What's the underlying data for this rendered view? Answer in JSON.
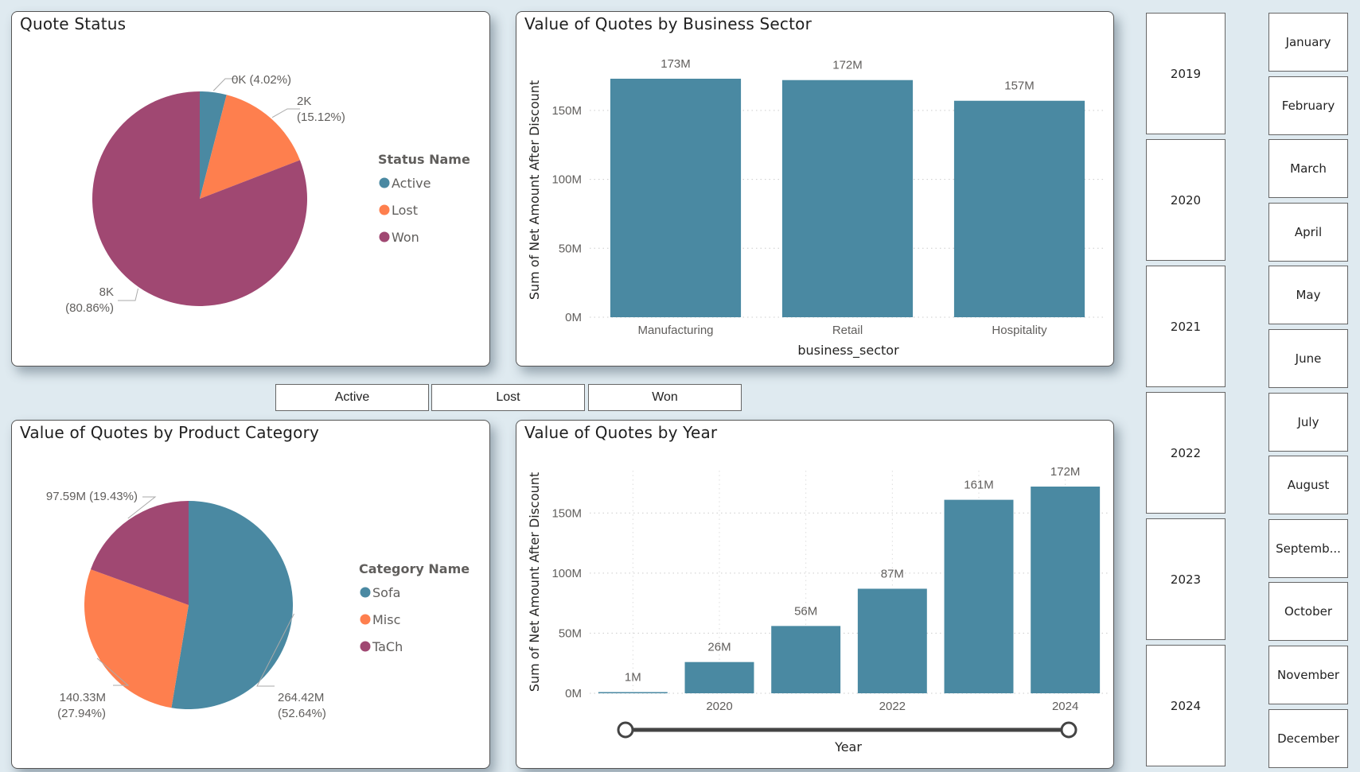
{
  "colors": {
    "teal": "#4a89a2",
    "orange": "#fe7f4e",
    "plum": "#a04872",
    "background": "#dfeaf0"
  },
  "status_buttons": [
    "Active",
    "Lost",
    "Won"
  ],
  "year_slicer": [
    "2019",
    "2020",
    "2021",
    "2022",
    "2023",
    "2024"
  ],
  "month_slicer": [
    "January",
    "February",
    "March",
    "April",
    "May",
    "June",
    "July",
    "August",
    "Septemb...",
    "October",
    "November",
    "December"
  ],
  "chart_data": [
    {
      "id": "quote-status",
      "type": "pie",
      "title": "Quote Status",
      "legend_title": "Status Name",
      "legend_position": "right",
      "categories": [
        "Active",
        "Lost",
        "Won"
      ],
      "values_pct": [
        4.02,
        15.12,
        80.86
      ],
      "data_labels": [
        "0K (4.02%)",
        "2K\n(15.12%)",
        "8K\n(80.86%)"
      ],
      "colors": [
        "#4a89a2",
        "#fe7f4e",
        "#a04872"
      ]
    },
    {
      "id": "business-sector",
      "type": "bar",
      "title": "Value of Quotes by Business Sector",
      "xlabel": "business_sector",
      "ylabel": "Sum of Net Amount After Discount",
      "categories": [
        "Manufacturing",
        "Retail",
        "Hospitality"
      ],
      "values": [
        173,
        172,
        157
      ],
      "value_unit": "M",
      "data_labels": [
        "173M",
        "172M",
        "157M"
      ],
      "ylim": [
        0,
        173
      ],
      "yticks": [
        0,
        50,
        100,
        150
      ],
      "ytick_labels": [
        "0M",
        "50M",
        "100M",
        "150M"
      ],
      "grid": true
    },
    {
      "id": "product-category",
      "type": "pie",
      "title": "Value of Quotes by Product Category",
      "legend_title": "Category Name",
      "legend_position": "right",
      "categories": [
        "Sofa",
        "Misc",
        "TaCh"
      ],
      "values": [
        264.42,
        140.33,
        97.59
      ],
      "values_pct": [
        52.64,
        27.94,
        19.43
      ],
      "data_labels": [
        "264.42M\n(52.64%)",
        "140.33M\n(27.94%)",
        "97.59M (19.43%)"
      ],
      "colors": [
        "#4a89a2",
        "#fe7f4e",
        "#a04872"
      ]
    },
    {
      "id": "quotes-by-year",
      "type": "bar",
      "title": "Value of Quotes by Year",
      "xlabel": "Year",
      "ylabel": "Sum of Net Amount After Discount",
      "categories": [
        "2019",
        "2020",
        "2021",
        "2022",
        "2023",
        "2024"
      ],
      "xtick_labels": [
        "",
        "2020",
        "",
        "2022",
        "",
        "2024"
      ],
      "values": [
        1,
        26,
        56,
        87,
        161,
        172
      ],
      "value_unit": "M",
      "data_labels": [
        "1M",
        "26M",
        "56M",
        "87M",
        "161M",
        "172M"
      ],
      "ylim": [
        0,
        172
      ],
      "yticks": [
        0,
        50,
        100,
        150
      ],
      "ytick_labels": [
        "0M",
        "50M",
        "100M",
        "150M"
      ],
      "grid": true,
      "range_slider": {
        "min": "2019",
        "max": "2024",
        "selected_min": "2019",
        "selected_max": "2024"
      }
    }
  ]
}
